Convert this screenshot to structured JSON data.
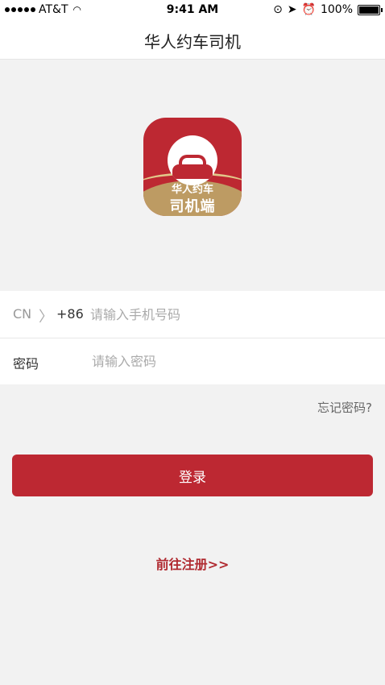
{
  "status_bar": {
    "carrier": "AT&T",
    "time": "9:41 AM",
    "battery": "100%"
  },
  "nav": {
    "title": "华人约车司机"
  },
  "logo": {
    "line1": "华人约车",
    "line2": "司机端"
  },
  "form": {
    "country": "CN",
    "dial_code": "+86",
    "phone_placeholder": "请输入手机号码",
    "password_label": "密码",
    "password_placeholder": "请输入密码"
  },
  "forgot_password": "忘记密码?",
  "login_button": "登录",
  "register_link": "前往注册>>",
  "colors": {
    "brand_red": "#bd2832",
    "gold": "#bd9b63"
  }
}
